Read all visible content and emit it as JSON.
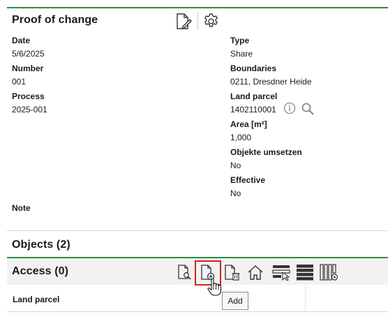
{
  "proof": {
    "title": "Proof of change",
    "left_fields": [
      {
        "label": "Date",
        "value": "5/6/2025"
      },
      {
        "label": "Number",
        "value": "001"
      },
      {
        "label": "Process",
        "value": "2025-001"
      }
    ],
    "right": {
      "type_label": "Type",
      "type_value": "Share",
      "boundaries_label": "Boundaries",
      "boundaries_value": "0211, Dresdner Heide",
      "parcel_label": "Land parcel",
      "parcel_value": "1402110001",
      "area_label": "Area [m²]",
      "area_value": "1,000",
      "objekte_label": "Objekte umsetzen",
      "objekte_value": "No",
      "effective_label": "Effective",
      "effective_value": "No"
    },
    "note_label": "Note"
  },
  "objects": {
    "title": "Objects (2)"
  },
  "access": {
    "title": "Access (0)",
    "column_land_parcel": "Land parcel",
    "tooltip": "Add"
  },
  "icons": [
    "edit-document-icon",
    "gear-icon",
    "info-icon",
    "search-icon",
    "document-search-icon",
    "document-add-icon",
    "document-delete-icon",
    "home-icon",
    "rows-select-icon",
    "list-icon",
    "columns-settings-icon",
    "cursor-pointer-icon"
  ],
  "colors": {
    "accent_green": "#2e8b3e",
    "highlight_red": "#d62020"
  }
}
